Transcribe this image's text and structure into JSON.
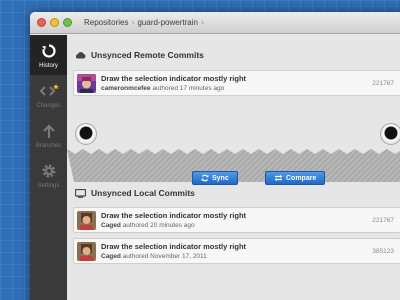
{
  "breadcrumb": {
    "root": "Repositories",
    "repo": "guard-powertrain"
  },
  "sidebar": {
    "items": [
      {
        "label": "History"
      },
      {
        "label": "Changes"
      },
      {
        "label": "Branches"
      },
      {
        "label": "Settings"
      }
    ]
  },
  "remote": {
    "title": "Unsynced Remote Commits",
    "commits": [
      {
        "message": "Draw the selection indicator mostly right",
        "author": "cameronmcefee",
        "time": "authored 17 minutes ago",
        "sha": "221767"
      }
    ]
  },
  "actions": {
    "sync": "Sync",
    "compare": "Compare"
  },
  "local": {
    "title": "Unsynced Local Commits",
    "commits": [
      {
        "message": "Draw the selection indicator mostly right",
        "author": "Caged",
        "time": "authored 20 minutes ago",
        "sha": "221767"
      },
      {
        "message": "Draw the selection indicator mostly right",
        "author": "Caged",
        "time": "authored November 17, 2011",
        "sha": "385123"
      }
    ]
  },
  "colors": {
    "accent": "#2f7bd6",
    "desktop": "#2f6fb7",
    "sidebar": "#3a3a3a"
  }
}
